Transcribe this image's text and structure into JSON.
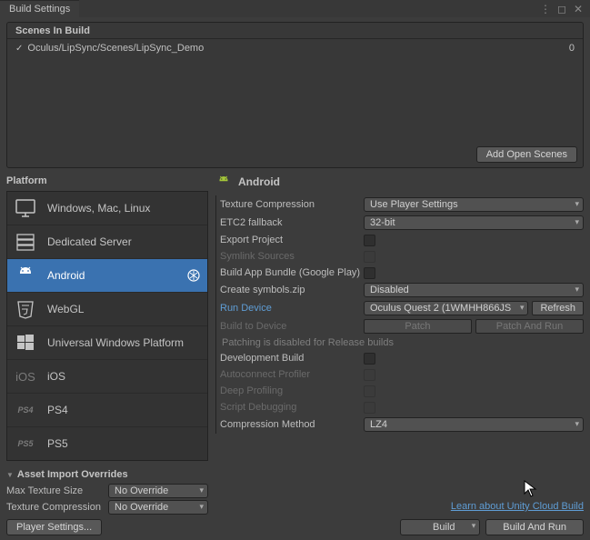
{
  "window": {
    "title": "Build Settings"
  },
  "scenes": {
    "header": "Scenes In Build",
    "items": [
      {
        "path": "Oculus/LipSync/Scenes/LipSync_Demo",
        "index": "0"
      }
    ],
    "addOpenScenes": "Add Open Scenes"
  },
  "platformHeader": "Platform",
  "platforms": [
    {
      "name": "Windows, Mac, Linux"
    },
    {
      "name": "Dedicated Server"
    },
    {
      "name": "Android"
    },
    {
      "name": "WebGL"
    },
    {
      "name": "Universal Windows Platform"
    },
    {
      "name": "iOS"
    },
    {
      "name": "PS4"
    },
    {
      "name": "PS5"
    }
  ],
  "overrides": {
    "header": "Asset Import Overrides",
    "maxTexLabel": "Max Texture Size",
    "maxTexValue": "No Override",
    "texCompLabel": "Texture Compression",
    "texCompValue": "No Override"
  },
  "playerSettings": "Player Settings...",
  "rightHeader": "Android",
  "settings": {
    "textureCompression": {
      "label": "Texture Compression",
      "value": "Use Player Settings"
    },
    "etc2": {
      "label": "ETC2 fallback",
      "value": "32-bit"
    },
    "exportProject": {
      "label": "Export Project"
    },
    "symlink": {
      "label": "Symlink Sources"
    },
    "buildAppBundle": {
      "label": "Build App Bundle (Google Play)"
    },
    "symbols": {
      "label": "Create symbols.zip",
      "value": "Disabled"
    },
    "runDevice": {
      "label": "Run Device",
      "value": "Oculus Quest 2 (1WMHH866JS",
      "refresh": "Refresh"
    },
    "buildToDevice": {
      "label": "Build to Device",
      "patch": "Patch",
      "patchRun": "Patch And Run"
    },
    "patchHint": "Patching is disabled for Release builds",
    "devBuild": {
      "label": "Development Build"
    },
    "autoconnect": {
      "label": "Autoconnect Profiler"
    },
    "deepProfiling": {
      "label": "Deep Profiling"
    },
    "scriptDebug": {
      "label": "Script Debugging"
    },
    "compression": {
      "label": "Compression Method",
      "value": "LZ4"
    }
  },
  "cloudLink": "Learn about Unity Cloud Build",
  "buttons": {
    "build": "Build",
    "buildAndRun": "Build And Run"
  }
}
